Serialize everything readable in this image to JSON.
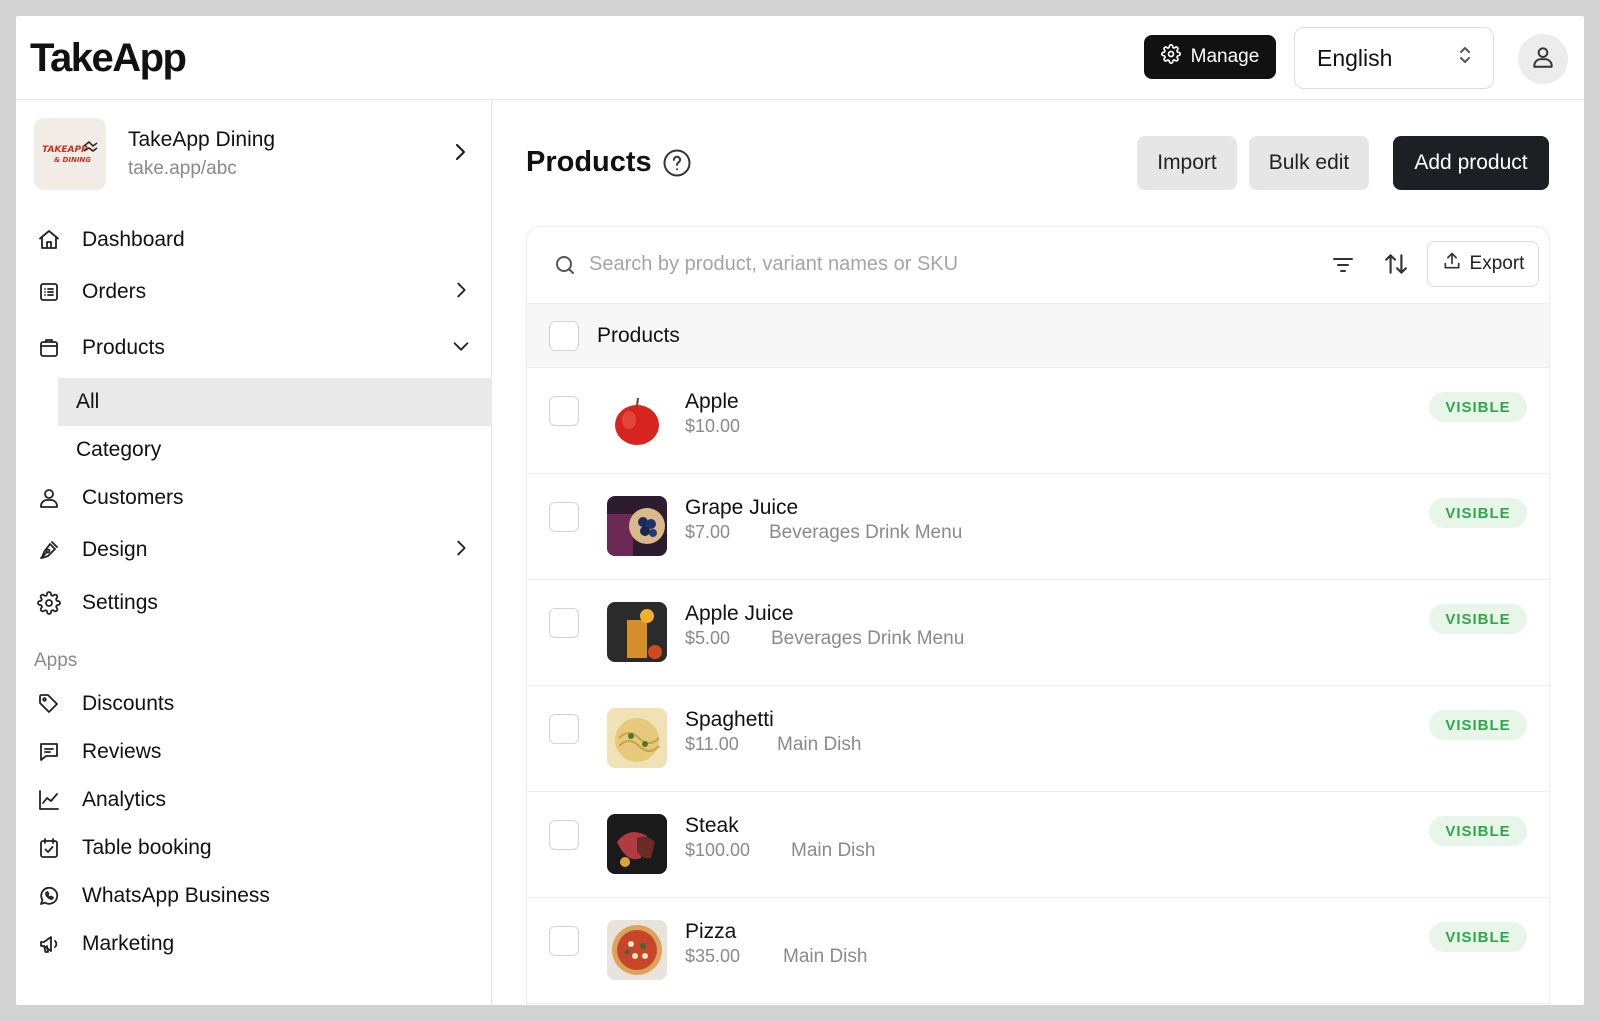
{
  "header": {
    "logo": "TakeApp",
    "manage_label": "Manage",
    "language": "English"
  },
  "store": {
    "name": "TakeApp Dining",
    "url": "take.app/abc",
    "logo_text": "TAKEAPP & DINING"
  },
  "sidebar": {
    "items": [
      {
        "label": "Dashboard",
        "icon": "home-icon"
      },
      {
        "label": "Orders",
        "icon": "orders-icon"
      },
      {
        "label": "Products",
        "icon": "products-icon"
      },
      {
        "label": "Customers",
        "icon": "user-icon"
      },
      {
        "label": "Design",
        "icon": "pen-icon"
      },
      {
        "label": "Settings",
        "icon": "gear-icon"
      }
    ],
    "product_sub": [
      {
        "label": "All",
        "active": true
      },
      {
        "label": "Category",
        "active": false
      }
    ],
    "apps_label": "Apps",
    "apps": [
      {
        "label": "Discounts",
        "icon": "tag-icon"
      },
      {
        "label": "Reviews",
        "icon": "message-icon"
      },
      {
        "label": "Analytics",
        "icon": "chart-icon"
      },
      {
        "label": "Table booking",
        "icon": "calendar-icon"
      },
      {
        "label": "WhatsApp Business",
        "icon": "whatsapp-icon"
      },
      {
        "label": "Marketing",
        "icon": "megaphone-icon"
      }
    ]
  },
  "main": {
    "title": "Products",
    "import_label": "Import",
    "bulk_edit_label": "Bulk edit",
    "add_product_label": "Add product",
    "search_placeholder": "Search by product, variant names or SKU",
    "export_label": "Export",
    "list_header": "Products",
    "products": [
      {
        "name": "Apple",
        "price": "$10.00",
        "category": "",
        "status": "VISIBLE"
      },
      {
        "name": "Grape Juice",
        "price": "$7.00",
        "category": "Beverages Drink Menu",
        "status": "VISIBLE"
      },
      {
        "name": "Apple Juice",
        "price": "$5.00",
        "category": "Beverages Drink Menu",
        "status": "VISIBLE"
      },
      {
        "name": "Spaghetti",
        "price": "$11.00",
        "category": "Main Dish",
        "status": "VISIBLE"
      },
      {
        "name": "Steak",
        "price": "$100.00",
        "category": "Main Dish",
        "status": "VISIBLE"
      },
      {
        "name": "Pizza",
        "price": "$35.00",
        "category": "Main Dish",
        "status": "VISIBLE"
      }
    ]
  },
  "colors": {
    "primary_dark": "#1c1f24",
    "visible_badge_bg": "#e8f6ea",
    "visible_badge_text": "#2fa84b"
  }
}
